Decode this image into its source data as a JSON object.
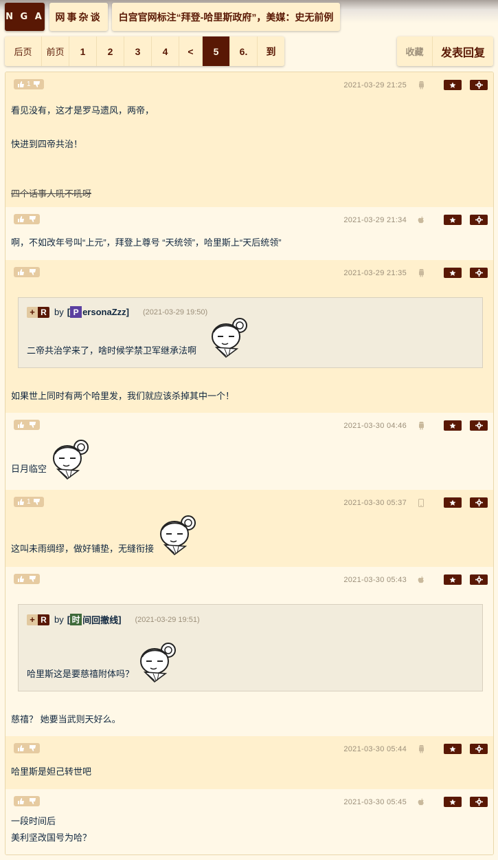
{
  "header": {
    "logo": "N G A",
    "forum": "网事杂谈",
    "thread_title": "白宫官网标注“拜登-哈里斯政府”，美媒：史无前例"
  },
  "pager": {
    "first": "后页",
    "prev": "前页",
    "pages": [
      "1",
      "2",
      "3",
      "4",
      "<",
      "5",
      "6.",
      "到"
    ],
    "current": "5"
  },
  "actions": {
    "favorite": "收藏",
    "reply": "发表回复"
  },
  "colors": {
    "brand": "#591804",
    "panel": "#fff0cd",
    "panel_alt": "#fff8e7",
    "text": "#10273f",
    "muted": "#9c8f7a"
  },
  "posts": [
    {
      "votes": "1",
      "time": "2021-03-29 21:25",
      "device": "android-icon",
      "lines": [
        "看见没有，这才是罗马遗风，两帝，",
        "快进到四帝共治！"
      ],
      "struck": "四个话事人吼不吼呀"
    },
    {
      "votes": "",
      "time": "2021-03-29 21:34",
      "device": "apple-icon",
      "lines": [
        "啊，不如改年号叫“上元”，拜登上尊号 “天统领”，哈里斯上“天后统领”"
      ]
    },
    {
      "votes": "",
      "time": "2021-03-29 21:35",
      "device": "android-icon",
      "quote": {
        "plus": "+",
        "r": "R",
        "by": "by",
        "avatar": "P",
        "user": "ersonaZzz",
        "time": "(2021-03-29 19:50)",
        "text": "二帝共治学来了，啥时候学禁卫军继承法啊"
      },
      "lines": [
        "如果世上同时有两个哈里发，我们就应该杀掉其中一个！"
      ]
    },
    {
      "votes": "",
      "time": "2021-03-30 04:46",
      "device": "android-icon",
      "lines": [
        "日月临空"
      ]
    },
    {
      "votes": "1",
      "time": "2021-03-30 05:37",
      "device": "phone-icon",
      "lines": [
        "这叫未雨绸缪，做好铺垫，无缝衔接"
      ]
    },
    {
      "votes": "",
      "time": "2021-03-30 05:43",
      "device": "apple-icon",
      "quote": {
        "plus": "+",
        "r": "R",
        "by": "by",
        "avatar": "时",
        "user": "间回撤线",
        "time": "(2021-03-29 19:51)",
        "text": "哈里斯这是要慈禧附体吗？"
      },
      "lines": [
        "慈禧？ 她要当武则天好么。"
      ]
    },
    {
      "votes": "",
      "time": "2021-03-30 05:44",
      "device": "android-icon",
      "lines": [
        "哈里斯是妲己转世吧"
      ]
    },
    {
      "votes": "",
      "time": "2021-03-30 05:45",
      "device": "apple-icon",
      "lines": [
        "一段时间后",
        "美利坚改国号为哈？"
      ]
    }
  ]
}
